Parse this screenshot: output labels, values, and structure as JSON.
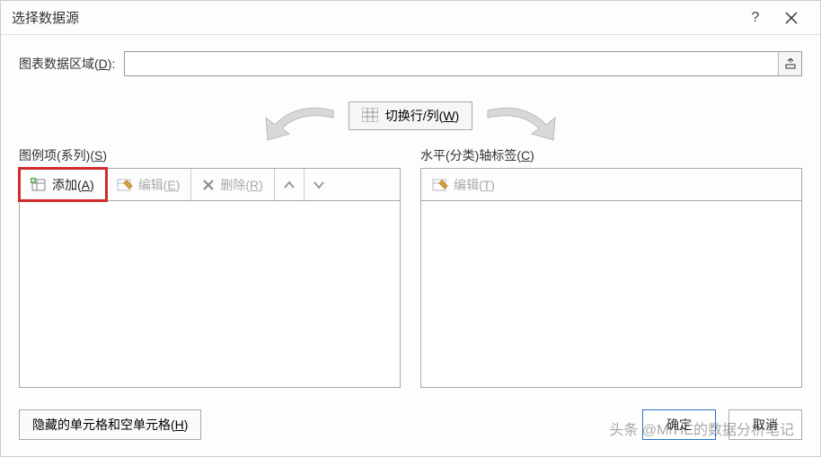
{
  "titlebar": {
    "title": "选择数据源",
    "help": "?",
    "close": "×"
  },
  "range": {
    "label_prefix": "图表数据区域(",
    "label_key": "D",
    "label_suffix": "):",
    "value": ""
  },
  "swap": {
    "label_prefix": "切换行/列(",
    "label_key": "W",
    "label_suffix": ")"
  },
  "legend": {
    "section_label_prefix": "图例项(系列)(",
    "section_label_key": "S",
    "section_label_suffix": ")",
    "add_prefix": "添加(",
    "add_key": "A",
    "add_suffix": ")",
    "edit_prefix": "编辑(",
    "edit_key": "E",
    "edit_suffix": ")",
    "remove_prefix": "删除(",
    "remove_key": "R",
    "remove_suffix": ")"
  },
  "axis": {
    "section_label_prefix": "水平(分类)轴标签(",
    "section_label_key": "C",
    "section_label_suffix": ")",
    "edit_prefix": "编辑(",
    "edit_key": "T",
    "edit_suffix": ")"
  },
  "footer": {
    "hidden_prefix": "隐藏的单元格和空单元格(",
    "hidden_key": "H",
    "hidden_suffix": ")",
    "ok": "确定",
    "cancel": "取消"
  },
  "watermark": "头条 @MrHE的数据分析笔记"
}
